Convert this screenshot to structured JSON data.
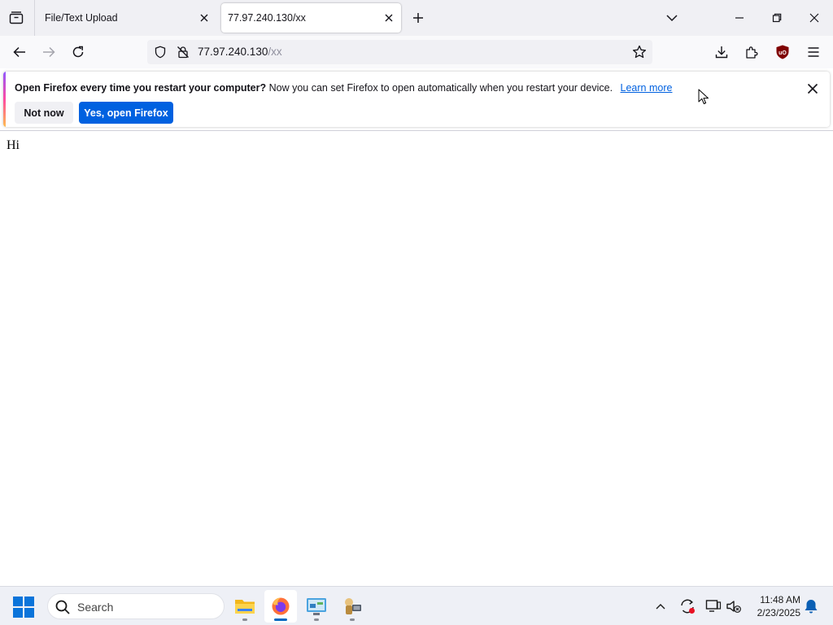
{
  "browser": {
    "tabs": [
      {
        "title": "File/Text Upload",
        "active": false
      },
      {
        "title": "77.97.240.130/xx",
        "active": true
      }
    ],
    "url": {
      "host": "77.97.240.130",
      "path": "/xx"
    }
  },
  "notification": {
    "bold": "Open Firefox every time you restart your computer?",
    "message": "Now you can set Firefox to open automatically when you restart your device.",
    "link": "Learn more",
    "buttons": {
      "not_now": "Not now",
      "yes": "Yes, open Firefox"
    }
  },
  "page": {
    "text": "Hi"
  },
  "taskbar": {
    "search_label": "Search",
    "apps": [
      {
        "icon": "file-explorer-icon",
        "state": "running"
      },
      {
        "icon": "firefox-icon",
        "state": "active"
      },
      {
        "icon": "control-panel-icon",
        "state": "running"
      },
      {
        "icon": "app-icon",
        "state": "running"
      }
    ],
    "clock": {
      "time": "11:48 AM",
      "date": "2/23/2025"
    }
  },
  "colors": {
    "accent": "#0061e0",
    "ublock": "#800000",
    "windows_blue": "#0a74da"
  }
}
